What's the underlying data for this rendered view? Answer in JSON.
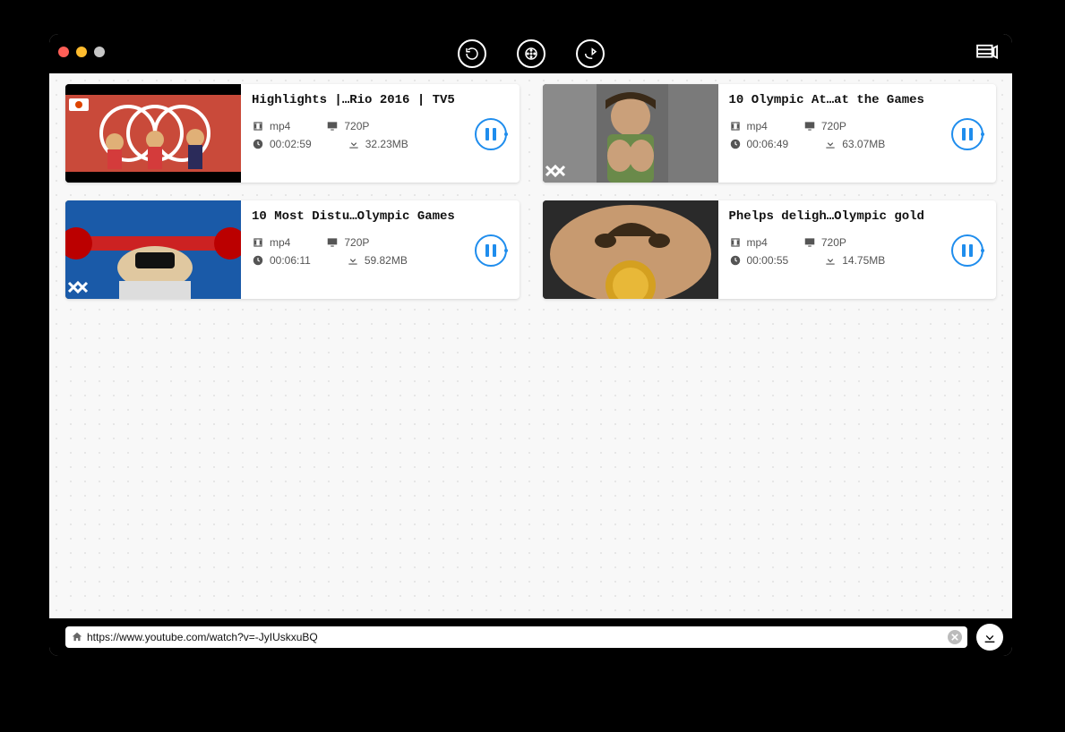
{
  "url": "https://www.youtube.com/watch?v=-JyIUskxuBQ",
  "videos": [
    {
      "title": "Highlights |…Rio 2016 | TV5",
      "format": "mp4",
      "resolution": "720P",
      "duration": "00:02:59",
      "size": "32.23MB"
    },
    {
      "title": "10 Olympic At…at the Games",
      "format": "mp4",
      "resolution": "720P",
      "duration": "00:06:49",
      "size": "63.07MB"
    },
    {
      "title": "10 Most Distu…Olympic Games",
      "format": "mp4",
      "resolution": "720P",
      "duration": "00:06:11",
      "size": "59.82MB"
    },
    {
      "title": "Phelps deligh…Olympic gold",
      "format": "mp4",
      "resolution": "720P",
      "duration": "00:00:55",
      "size": "14.75MB"
    }
  ]
}
